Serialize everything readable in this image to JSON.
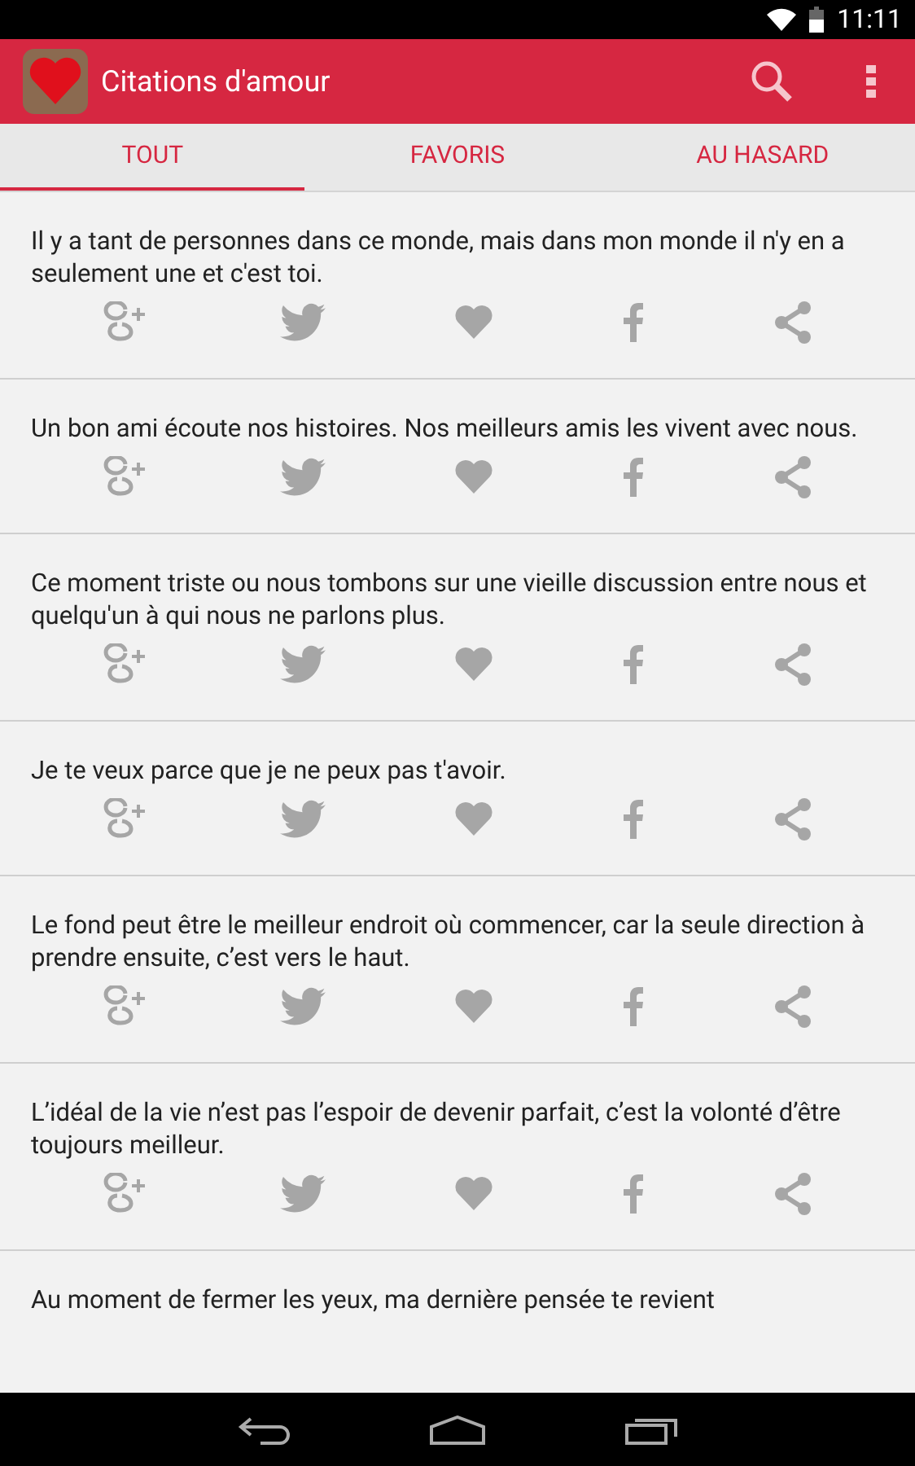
{
  "status_bar": {
    "time": "11:11"
  },
  "app_bar": {
    "title": "Citations d'amour"
  },
  "tabs": [
    {
      "label": "TOUT",
      "selected": true
    },
    {
      "label": "FAVORIS",
      "selected": false
    },
    {
      "label": "AU HASARD",
      "selected": false
    }
  ],
  "quotes": [
    {
      "text": "Il y a tant de personnes dans ce monde, mais dans mon monde il n'y en a seulement une et c'est toi.",
      "favorite": false
    },
    {
      "text": "Un bon ami écoute nos histoires. Nos meilleurs amis les vivent avec nous.",
      "favorite": false
    },
    {
      "text": "Ce moment triste ou nous tombons sur une vieille discussion entre nous et quelqu'un à qui nous ne parlons plus.",
      "favorite": false
    },
    {
      "text": "Je te veux parce que je ne peux pas t'avoir.",
      "favorite": false
    },
    {
      "text": "Le fond peut être le meilleur endroit où commencer, car la seule direction à prendre ensuite, c’est vers le haut.",
      "favorite": false
    },
    {
      "text": "L’idéal de la vie n’est pas l’espoir de devenir parfait, c’est la volonté d’être toujours meilleur.",
      "favorite": false
    },
    {
      "text": "Au moment de fermer les yeux, ma dernière pensée te revient"
    }
  ]
}
